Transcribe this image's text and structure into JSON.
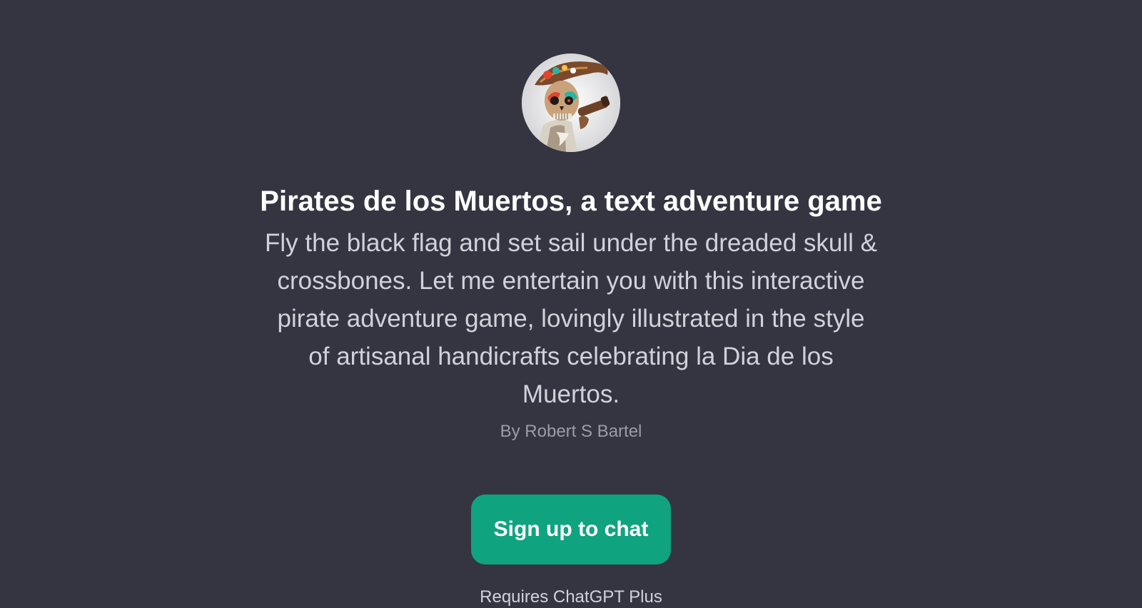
{
  "gpt": {
    "avatar_icon": "skull-pirate-avatar",
    "title": "Pirates de los Muertos, a text adventure game",
    "description": "Fly the black flag and set sail under the dreaded skull & crossbones. Let me entertain you with this interactive pirate adventure game, lovingly illustrated in the style of artisanal handicrafts celebrating la Dia de los Muertos.",
    "author": "By Robert S Bartel"
  },
  "cta": {
    "label": "Sign up to chat"
  },
  "footer": {
    "note": "Requires ChatGPT Plus"
  },
  "colors": {
    "background": "#343541",
    "accent": "#10a37f",
    "title": "#ffffff",
    "description": "#d1d1da",
    "author": "#9c9ca6"
  }
}
